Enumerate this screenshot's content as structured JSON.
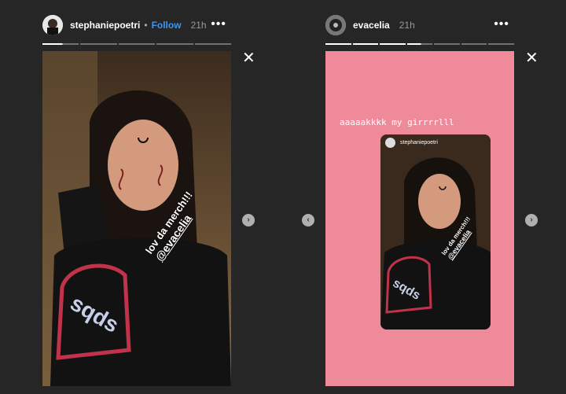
{
  "story_left": {
    "username": "stephaniepoetri",
    "follow_label": "Follow",
    "time": "21h",
    "menu_glyph": "•••",
    "sticker_text": "lov da merch!!!",
    "sticker_mention": "@evacelia",
    "progress": {
      "segments": 5,
      "current": 0
    }
  },
  "story_right": {
    "username": "evacelia",
    "time": "21h",
    "menu_glyph": "•••",
    "caption": "aaaaakkkk my girrrrlll",
    "shared_username": "stephaniepoetri",
    "shared_sticker_text": "lov da merch!!!",
    "shared_sticker_mention": "@evacelia",
    "background_color": "#ef8a9a",
    "progress": {
      "segments": 7,
      "current": 3
    }
  },
  "controls": {
    "close_glyph": "✕",
    "next_glyph": "›",
    "prev_glyph": "‹"
  },
  "icons": [
    "close-icon",
    "chevron-right-icon",
    "chevron-left-icon",
    "more-icon"
  ],
  "colors": {
    "background": "#262626",
    "follow": "#3897f0",
    "pink": "#ef8a9a"
  }
}
